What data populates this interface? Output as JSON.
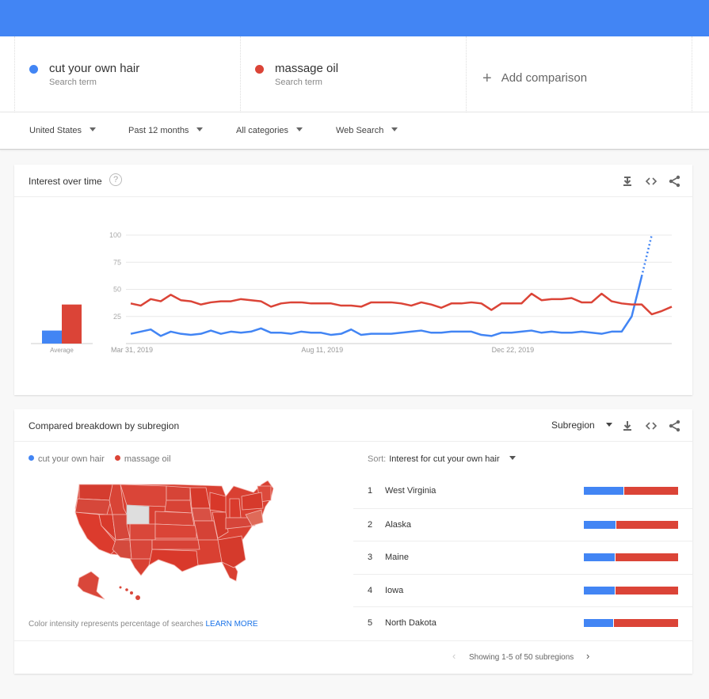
{
  "colors": {
    "term1": "#4285f4",
    "term2": "#db4437",
    "topbar": "#4285f4"
  },
  "terms": [
    {
      "name": "cut your own hair",
      "type": "Search term"
    },
    {
      "name": "massage oil",
      "type": "Search term"
    }
  ],
  "add_comparison": {
    "icon": "plus-icon",
    "label": "Add comparison"
  },
  "filters": [
    {
      "label": "United States"
    },
    {
      "label": "Past 12 months"
    },
    {
      "label": "All categories"
    },
    {
      "label": "Web Search"
    }
  ],
  "interest_over_time": {
    "title": "Interest over time",
    "help_icon": "?",
    "icons": [
      "download-icon",
      "embed-icon",
      "share-icon"
    ]
  },
  "chart_data": {
    "type": "line",
    "title": "Interest over time",
    "xlabel": "",
    "ylabel": "",
    "ylim": [
      0,
      100
    ],
    "yticks": [
      25,
      50,
      75,
      100
    ],
    "xtick_labels": [
      "Mar 31, 2019",
      "Aug 11, 2019",
      "Dec 22, 2019"
    ],
    "xtick_index": [
      0,
      19,
      38
    ],
    "grid": true,
    "average": {
      "label": "Average",
      "values": [
        12,
        36
      ]
    },
    "series": [
      {
        "name": "cut your own hair",
        "color": "#4285f4",
        "values": [
          9,
          11,
          13,
          7,
          11,
          9,
          8,
          9,
          12,
          9,
          11,
          10,
          11,
          14,
          10,
          10,
          9,
          11,
          10,
          10,
          8,
          9,
          13,
          8,
          9,
          9,
          9,
          10,
          11,
          12,
          10,
          10,
          11,
          11,
          11,
          8,
          7,
          10,
          10,
          11,
          12,
          10,
          11,
          10,
          10,
          11,
          10,
          9,
          11,
          11,
          25,
          62,
          100
        ],
        "partial_from_index": 51
      },
      {
        "name": "massage oil",
        "color": "#db4437",
        "values": [
          37,
          35,
          41,
          39,
          45,
          40,
          39,
          36,
          38,
          39,
          39,
          41,
          40,
          39,
          34,
          37,
          38,
          38,
          37,
          37,
          37,
          35,
          35,
          34,
          38,
          38,
          38,
          37,
          35,
          38,
          36,
          33,
          37,
          37,
          38,
          37,
          31,
          37,
          37,
          37,
          46,
          40,
          41,
          41,
          42,
          38,
          38,
          46,
          39,
          37,
          36,
          36,
          27,
          30,
          34
        ]
      }
    ]
  },
  "subregion": {
    "title": "Compared breakdown by subregion",
    "selector_label": "Subregion",
    "icons": [
      "download-icon",
      "embed-icon",
      "share-icon"
    ],
    "legend": [
      "cut your own hair",
      "massage oil"
    ],
    "sort_label": "Sort:",
    "sort_value": "Interest for cut your own hair",
    "map_note": "Color intensity represents percentage of searches",
    "learn_more": "LEARN MORE",
    "rows": [
      {
        "rank": "1",
        "name": "West Virginia",
        "share_term1": 0.42
      },
      {
        "rank": "2",
        "name": "Alaska",
        "share_term1": 0.34
      },
      {
        "rank": "3",
        "name": "Maine",
        "share_term1": 0.33
      },
      {
        "rank": "4",
        "name": "Iowa",
        "share_term1": 0.33
      },
      {
        "rank": "5",
        "name": "North Dakota",
        "share_term1": 0.31
      }
    ],
    "pager_text": "Showing 1-5 of 50 subregions"
  }
}
